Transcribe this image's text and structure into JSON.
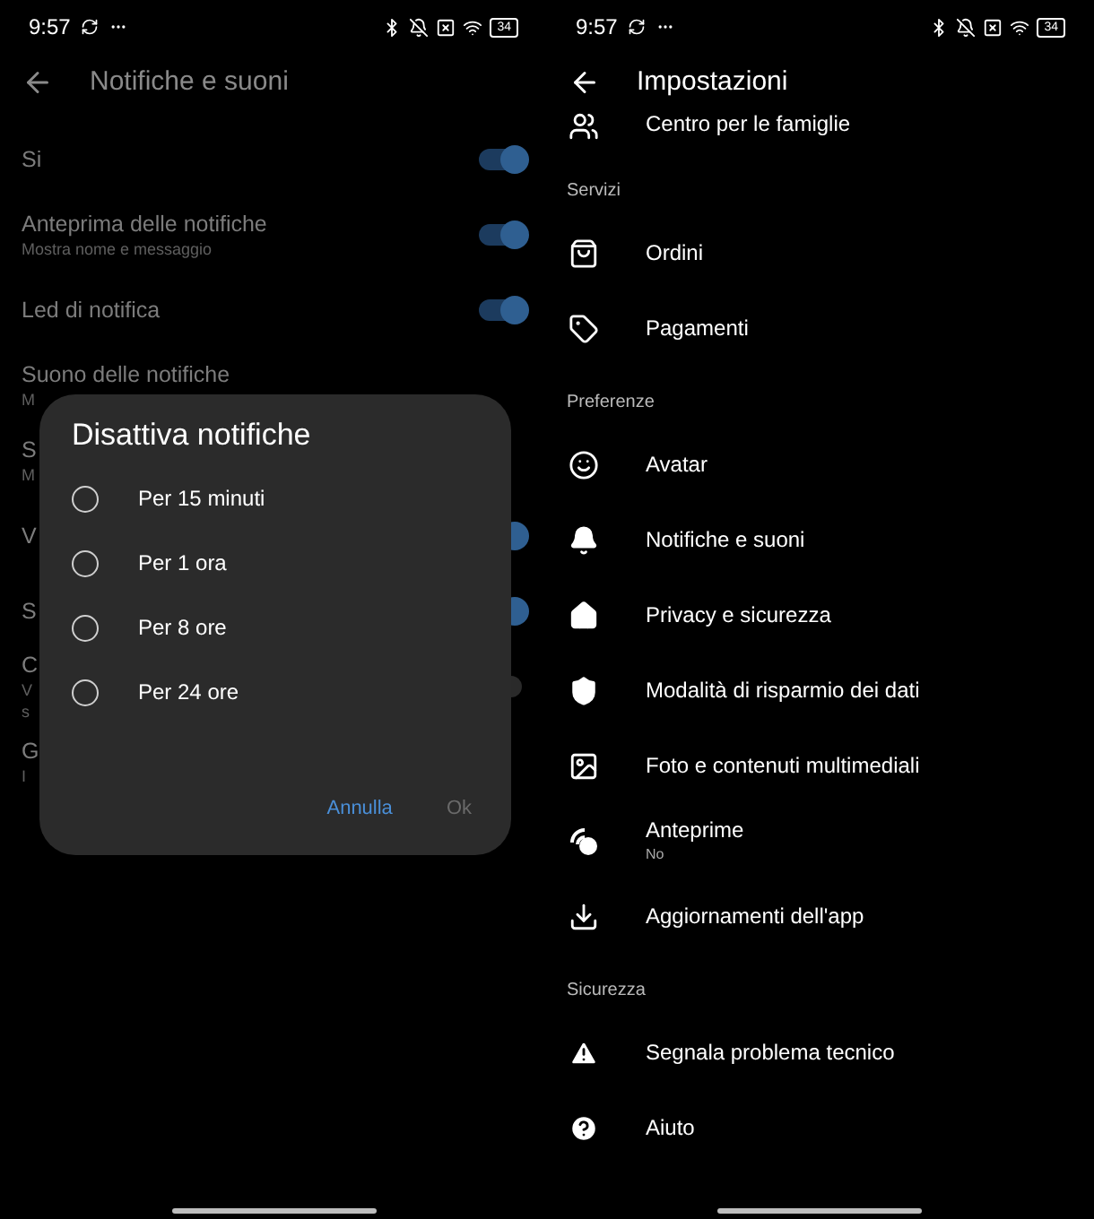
{
  "left": {
    "status": {
      "time": "9:57",
      "battery": "34"
    },
    "title": "Notifiche e suoni",
    "rows": [
      {
        "label": "Si",
        "on": true
      },
      {
        "label": "Anteprima delle notifiche",
        "subtitle": "Mostra nome e messaggio",
        "on": true
      },
      {
        "label": "Led di notifica",
        "on": true
      },
      {
        "label": "Suono delle notifiche",
        "subtitle": "M"
      },
      {
        "label": "S",
        "subtitle": "M"
      },
      {
        "label": "V",
        "on": true
      },
      {
        "label": "S",
        "on": true
      },
      {
        "label": "C",
        "subtitle": "V",
        "subtitle2": "s",
        "on": false
      },
      {
        "label": "G",
        "subtitle": "I"
      }
    ],
    "dialog": {
      "title": "Disattiva notifiche",
      "options": [
        {
          "label": "Per 15 minuti",
          "selected": false
        },
        {
          "label": "Per 1 ora",
          "selected": false
        },
        {
          "label": "Per 8 ore",
          "selected": false
        },
        {
          "label": "Per 24 ore",
          "selected": false
        }
      ],
      "buttons": [
        {
          "label": "Annulla",
          "disabled": false
        },
        {
          "label": "Ok",
          "disabled": true
        }
      ]
    }
  },
  "right": {
    "status": {
      "time": "9:57",
      "battery": "34"
    },
    "title": "Impostazioni",
    "items": [
      {
        "kind": "item",
        "label": "Centro per le famiglie"
      },
      {
        "kind": "section",
        "label": "Servizi"
      },
      {
        "kind": "item",
        "label": "Ordini"
      },
      {
        "kind": "item",
        "label": "Pagamenti"
      },
      {
        "kind": "section",
        "label": "Preferenze"
      },
      {
        "kind": "item",
        "label": "Avatar"
      },
      {
        "kind": "item",
        "label": "Notifiche e suoni"
      },
      {
        "kind": "item",
        "label": "Privacy e sicurezza"
      },
      {
        "kind": "item",
        "label": "Modalità di risparmio dei dati"
      },
      {
        "kind": "item",
        "label": "Foto e contenuti multimediali"
      },
      {
        "kind": "item",
        "label": "Anteprime",
        "subtitle": "No"
      },
      {
        "kind": "item",
        "label": "Aggiornamenti dell'app"
      },
      {
        "kind": "section",
        "label": "Sicurezza"
      },
      {
        "kind": "item",
        "label": "Segnala problema tecnico"
      },
      {
        "kind": "item",
        "label": "Aiuto"
      }
    ]
  }
}
